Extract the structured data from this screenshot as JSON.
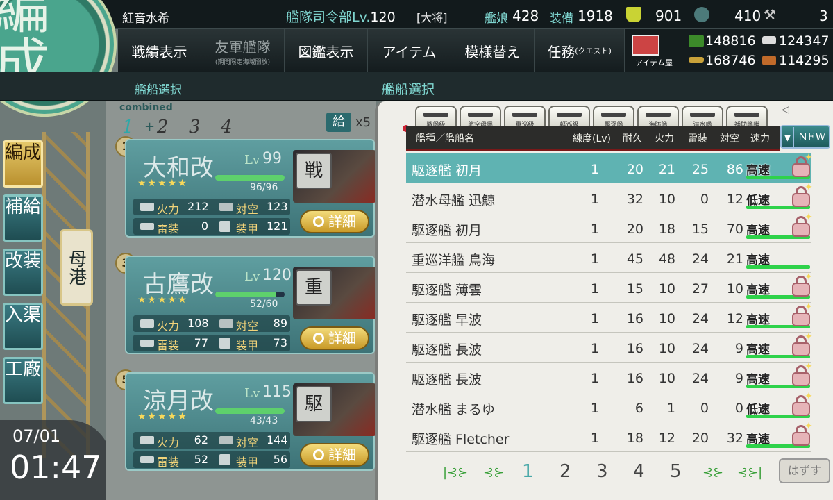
{
  "header": {
    "player_name": "紅音水希",
    "hq_label": "艦隊司令部Lv.",
    "hq_level": "120",
    "hq_rank": "[大将]",
    "shipgirls_label": "艦娘",
    "shipgirls_count": "428",
    "equipment_label": "装備",
    "equipment_count": "1918",
    "bucket_count": "901",
    "devmat_count": "410",
    "screw_count": "3"
  },
  "menu": {
    "items": [
      {
        "label": "戦績表示",
        "sub": ""
      },
      {
        "label": "友軍艦隊",
        "sub": "(期間限定海域開放)"
      },
      {
        "label": "図鑑表示",
        "sub": ""
      },
      {
        "label": "アイテム",
        "sub": ""
      },
      {
        "label": "模様替え",
        "sub": ""
      },
      {
        "label": "任務",
        "sub": "(クエスト)"
      }
    ],
    "shop_label": "アイテム屋"
  },
  "resources": {
    "fuel": "148816",
    "steel": "124347",
    "ammo": "168746",
    "bauxite": "114295"
  },
  "section": {
    "left_title": "艦船選択",
    "right_title": "艦船選択"
  },
  "logo_text": "編成",
  "nav": {
    "organize": "編成",
    "supply": "補給",
    "remodel": "改装",
    "repair": "入渠",
    "arsenal": "工廠",
    "port": "母港"
  },
  "clock": {
    "date": "07/01",
    "time": "01:47"
  },
  "fleet": {
    "combined_label": "combined",
    "tabs": [
      "1",
      "2",
      "3",
      "4"
    ],
    "supply_label": "給",
    "supply_x": "x5",
    "stat_labels": {
      "firepower": "火力",
      "aa": "対空",
      "torpedo": "雷装",
      "armor": "装甲"
    },
    "lv_label": "Lv",
    "detail_label": "詳細",
    "ships": [
      {
        "slot": "1",
        "name": "大和改",
        "level": "99",
        "hp": "96/96",
        "hp_ratio": 1.0,
        "stars": "★★★★★",
        "firepower": "212",
        "aa": "123",
        "torpedo": "0",
        "armor": "121",
        "type_badge": "戦"
      },
      {
        "slot": "3",
        "name": "古鷹改",
        "level": "120",
        "hp": "52/60",
        "hp_ratio": 0.87,
        "stars": "★★★★★",
        "firepower": "108",
        "aa": "89",
        "torpedo": "77",
        "armor": "73",
        "type_badge": "重"
      },
      {
        "slot": "5",
        "name": "涼月改",
        "level": "115",
        "hp": "43/43",
        "hp_ratio": 1.0,
        "stars": "★★★★★",
        "firepower": "62",
        "aa": "144",
        "torpedo": "52",
        "armor": "56",
        "type_badge": "駆"
      }
    ]
  },
  "shiplist": {
    "category_tabs": [
      "戦艦級",
      "航空母艦",
      "重巡級",
      "軽巡級",
      "駆逐艦",
      "海防艦",
      "潜水艦",
      "補助艦艇"
    ],
    "columns": {
      "name": "艦種／艦船名",
      "level": "練度(Lv)",
      "hp": "耐久",
      "firepower": "火力",
      "torpedo": "雷装",
      "aa": "対空",
      "speed": "速力"
    },
    "sort_label": "NEW",
    "rows": [
      {
        "name": "駆逐艦 初月",
        "level": "1",
        "hp": "20",
        "firepower": "21",
        "torpedo": "25",
        "aa": "86",
        "speed": "高速",
        "locked": true
      },
      {
        "name": "潜水母艦 迅鯨",
        "level": "1",
        "hp": "32",
        "firepower": "10",
        "torpedo": "0",
        "aa": "12",
        "speed": "低速",
        "locked": true
      },
      {
        "name": "駆逐艦 初月",
        "level": "1",
        "hp": "20",
        "firepower": "18",
        "torpedo": "15",
        "aa": "70",
        "speed": "高速",
        "locked": true
      },
      {
        "name": "重巡洋艦 鳥海",
        "level": "1",
        "hp": "45",
        "firepower": "48",
        "torpedo": "24",
        "aa": "21",
        "speed": "高速",
        "locked": false
      },
      {
        "name": "駆逐艦 薄雲",
        "level": "1",
        "hp": "15",
        "firepower": "10",
        "torpedo": "27",
        "aa": "10",
        "speed": "高速",
        "locked": true
      },
      {
        "name": "駆逐艦 早波",
        "level": "1",
        "hp": "16",
        "firepower": "10",
        "torpedo": "24",
        "aa": "12",
        "speed": "高速",
        "locked": true
      },
      {
        "name": "駆逐艦 長波",
        "level": "1",
        "hp": "16",
        "firepower": "10",
        "torpedo": "24",
        "aa": "9",
        "speed": "高速",
        "locked": true
      },
      {
        "name": "駆逐艦 長波",
        "level": "1",
        "hp": "16",
        "firepower": "10",
        "torpedo": "24",
        "aa": "9",
        "speed": "高速",
        "locked": true
      },
      {
        "name": "潜水艦 まるゆ",
        "level": "1",
        "hp": "6",
        "firepower": "1",
        "torpedo": "0",
        "aa": "0",
        "speed": "低速",
        "locked": true
      },
      {
        "name": "駆逐艦 Fletcher",
        "level": "1",
        "hp": "18",
        "firepower": "12",
        "torpedo": "20",
        "aa": "32",
        "speed": "高速",
        "locked": true
      }
    ],
    "pages": [
      "1",
      "2",
      "3",
      "4",
      "5"
    ],
    "current_page": "1",
    "remove_label": "はずす"
  },
  "colors": {
    "accent_teal": "#7fd6d0",
    "selected_row": "#5fb3b2",
    "speed_green": "#2ed24a"
  }
}
